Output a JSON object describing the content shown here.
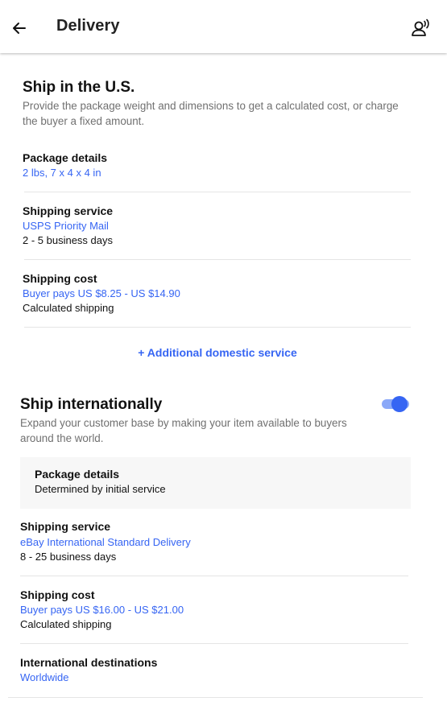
{
  "header": {
    "title": "Delivery",
    "back_icon": "arrow-left-icon",
    "voice_icon": "voice-assistant-icon"
  },
  "domestic": {
    "title": "Ship in the U.S.",
    "description": "Provide the package weight and dimensions to get a calculated cost, or charge the buyer a fixed amount.",
    "package_details": {
      "label": "Package details",
      "value": "2 lbs, 7 x 4 x 4 in"
    },
    "shipping_service": {
      "label": "Shipping service",
      "value": "USPS Priority Mail",
      "detail": "2 - 5 business days"
    },
    "shipping_cost": {
      "label": "Shipping cost",
      "value": "Buyer pays US $8.25 - US $14.90",
      "detail": "Calculated shipping"
    },
    "add_service_label": "+ Additional domestic service"
  },
  "international": {
    "title": "Ship internationally",
    "description": "Expand your customer base by making your item available to buyers around the world.",
    "toggle_on": true,
    "package_details": {
      "label": "Package details",
      "detail": "Determined by initial service"
    },
    "shipping_service": {
      "label": "Shipping service",
      "value": "eBay International Standard Delivery",
      "detail": "8 - 25 business days"
    },
    "shipping_cost": {
      "label": "Shipping cost",
      "value": "Buyer pays US $16.00 - US $21.00",
      "detail": "Calculated shipping"
    },
    "destinations": {
      "label": "International destinations",
      "value": "Worldwide"
    }
  },
  "colors": {
    "accent": "#3665f3",
    "accent_light": "#8aa8f8",
    "muted_text": "#707070",
    "divider": "#e5e5e5"
  }
}
